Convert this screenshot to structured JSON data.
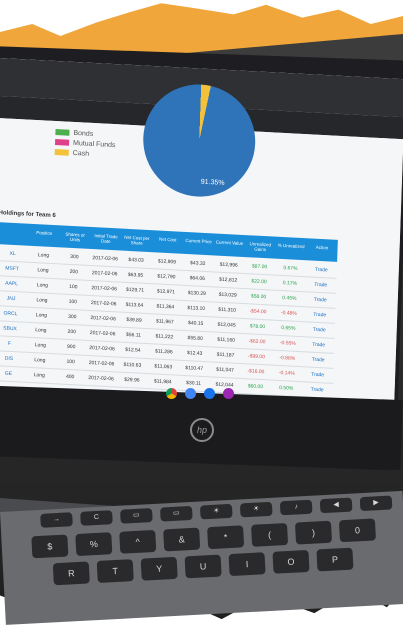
{
  "legend": [
    {
      "label": "Bonds",
      "color": "#4cae4c"
    },
    {
      "label": "Mutual Funds",
      "color": "#e0408a"
    },
    {
      "label": "Cash",
      "color": "#f4c23a"
    }
  ],
  "pie": {
    "label": "91.35%",
    "accent": "#2f73b8",
    "slice_color": "#f4c23a"
  },
  "holdings_title": "Holdings for Team 6",
  "columns": [
    "",
    "Position",
    "Shares or Units",
    "Initial Trade Date",
    "Net Cost per Share",
    "Net Cost",
    "Current Price",
    "Current Value",
    "Unrealized Gains",
    "% Unrealized",
    "Action"
  ],
  "rows": [
    [
      "XL",
      "Long",
      "300",
      "2017-02-06",
      "$43.03",
      "$12,909",
      "$43.32",
      "$12,996",
      "$87.00",
      "0.67%",
      "Trade"
    ],
    [
      "MSFT",
      "Long",
      "200",
      "2017-02-06",
      "$63.95",
      "$12,790",
      "$64.06",
      "$12,812",
      "$22.00",
      "0.17%",
      "Trade"
    ],
    [
      "AAPL",
      "Long",
      "100",
      "2017-02-06",
      "$129.71",
      "$12,971",
      "$130.29",
      "$13,029",
      "$58.00",
      "0.45%",
      "Trade"
    ],
    [
      "JNJ",
      "Long",
      "100",
      "2017-02-06",
      "$113.64",
      "$11,364",
      "$113.10",
      "$11,310",
      "-$54.00",
      "-0.48%",
      "Trade"
    ],
    [
      "ORCL",
      "Long",
      "300",
      "2017-02-06",
      "$39.89",
      "$11,967",
      "$40.15",
      "$12,045",
      "$78.00",
      "0.65%",
      "Trade"
    ],
    [
      "SBUX",
      "Long",
      "200",
      "2017-02-06",
      "$56.11",
      "$11,222",
      "$55.80",
      "$11,160",
      "-$62.00",
      "-0.55%",
      "Trade"
    ],
    [
      "F",
      "Long",
      "900",
      "2017-02-06",
      "$12.54",
      "$11,286",
      "$12.43",
      "$11,187",
      "-$99.00",
      "-0.88%",
      "Trade"
    ],
    [
      "DIS",
      "Long",
      "100",
      "2017-02-06",
      "$110.63",
      "$11,063",
      "$110.47",
      "$11,047",
      "-$16.00",
      "-0.14%",
      "Trade"
    ],
    [
      "GE",
      "Long",
      "400",
      "2017-02-06",
      "$29.96",
      "$11,984",
      "$30.11",
      "$12,044",
      "$60.00",
      "0.50%",
      "Trade"
    ]
  ],
  "keys": {
    "top": [
      "→",
      "C",
      "▭",
      "▭",
      "☀",
      "☀",
      "♪",
      "◀",
      "▶"
    ],
    "num": [
      "$",
      "%",
      "^",
      "&",
      "*",
      "(",
      ")",
      "0"
    ],
    "num_digits": [
      "4",
      "5",
      "6",
      "7",
      "8",
      "9",
      "0"
    ],
    "letters": [
      "R",
      "T",
      "Y",
      "U",
      "I",
      "O",
      "P"
    ]
  },
  "logo": "hp"
}
